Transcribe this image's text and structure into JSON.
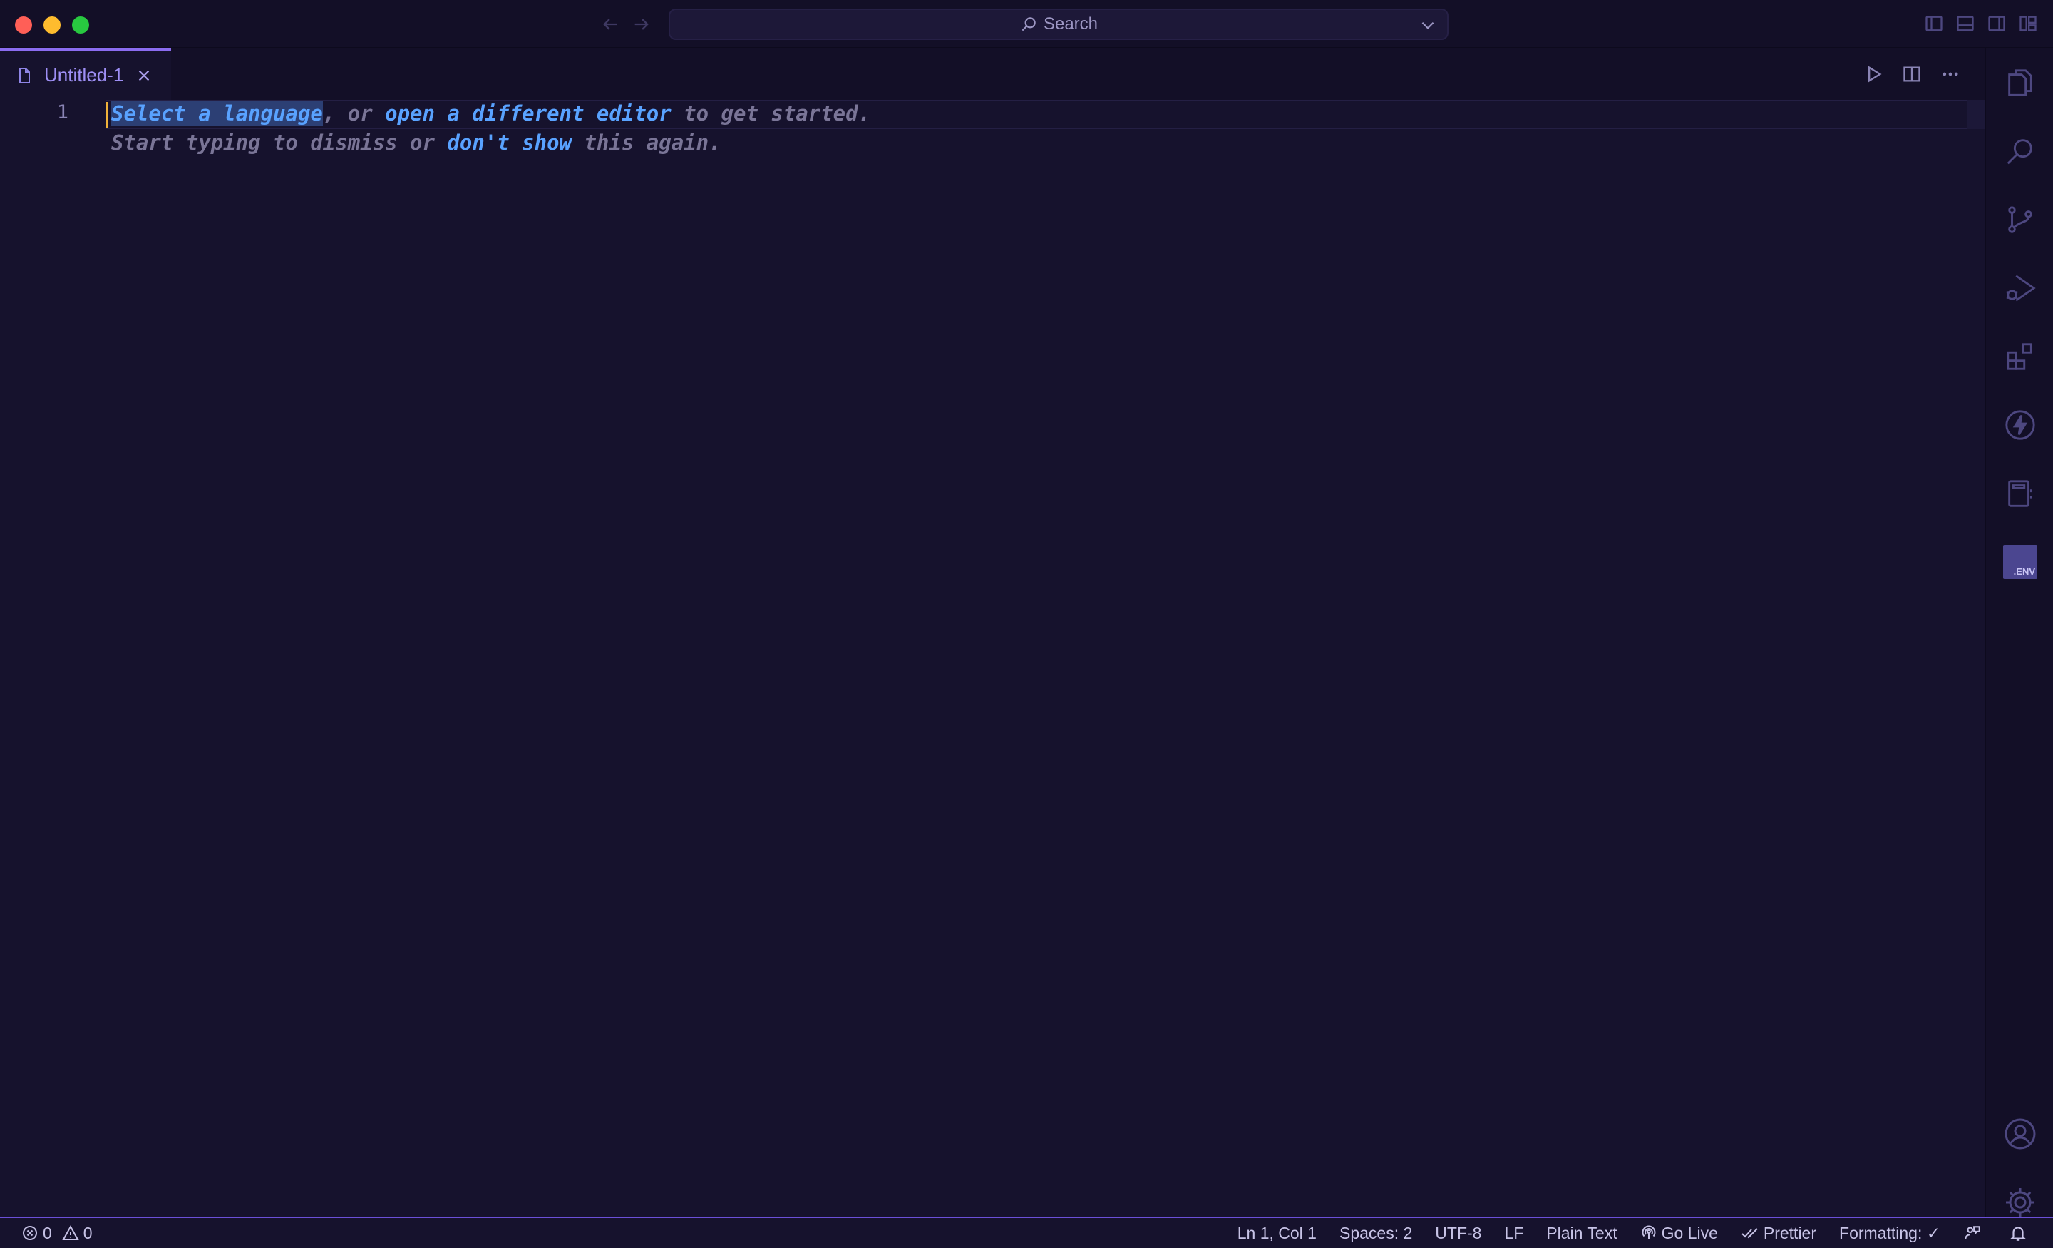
{
  "titlebar": {
    "search_placeholder": "Search"
  },
  "tabs": [
    {
      "label": "Untitled-1",
      "active": true
    }
  ],
  "editor": {
    "line_number": "1",
    "hint": {
      "line1": {
        "link1": "Select a language",
        "text1": ", or ",
        "link2": "open a different editor",
        "text2": " to get started."
      },
      "line2": {
        "text1": "Start typing to dismiss or ",
        "link": "don't show",
        "text2": " this again."
      }
    }
  },
  "activitybar": {
    "items": [
      "explorer-icon",
      "search-icon",
      "source-control-icon",
      "run-debug-icon",
      "extensions-icon",
      "lightning-icon",
      "notebook-icon",
      "env-icon"
    ],
    "env_label": ".ENV",
    "bottom": [
      "account-icon",
      "settings-gear-icon"
    ]
  },
  "statusbar": {
    "errors": "0",
    "warnings": "0",
    "position": "Ln 1, Col 1",
    "spaces": "Spaces: 2",
    "encoding": "UTF-8",
    "eol": "LF",
    "language": "Plain Text",
    "golive": "Go Live",
    "prettier": "Prettier",
    "formatting": "Formatting: ✓"
  },
  "colors": {
    "background": "#16122d",
    "accent": "#8b6cf0",
    "link": "#59a2ff",
    "cursor": "#f0b23a"
  }
}
